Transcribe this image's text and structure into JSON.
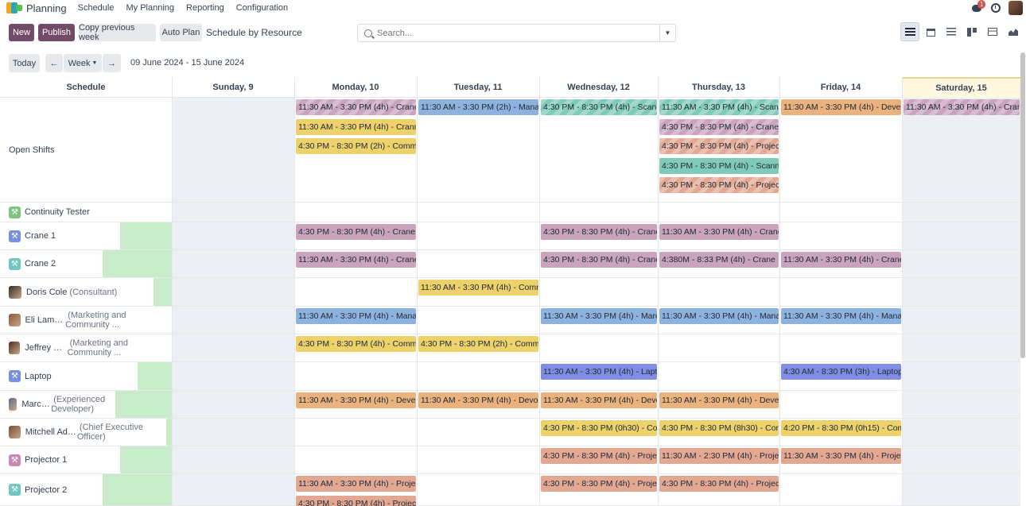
{
  "app": {
    "title": "Planning",
    "menu": [
      "Schedule",
      "My Planning",
      "Reporting",
      "Configuration"
    ],
    "notification_count": "1"
  },
  "toolbar": {
    "new_label": "New",
    "publish_label": "Publish",
    "copy_label": "Copy previous week",
    "autoplan_label": "Auto Plan",
    "view_title": "Schedule by Resource"
  },
  "search": {
    "placeholder": "Search..."
  },
  "navigation": {
    "today_label": "Today",
    "scale_label": "Week",
    "date_range": "09 June 2024 - 15 June 2024"
  },
  "grid": {
    "schedule_header": "Schedule",
    "days": [
      "Sunday, 9",
      "Monday, 10",
      "Tuesday, 11",
      "Wednesday, 12",
      "Thursday, 13",
      "Friday, 14",
      "Saturday, 15"
    ]
  },
  "rows": [
    {
      "name": "Open Shifts",
      "sub": "",
      "icon": "none"
    },
    {
      "name": "Continuity Tester",
      "sub": "",
      "icon": "wrench-icon",
      "icon_color": "#7cc47f"
    },
    {
      "name": "Crane 1",
      "sub": "",
      "icon": "wrench-icon",
      "icon_color": "#7b8fe0"
    },
    {
      "name": "Crane 2",
      "sub": "",
      "icon": "wrench-icon",
      "icon_color": "#6fc7c0"
    },
    {
      "name": "Doris Cole",
      "sub": "(Consultant)",
      "icon": "person-avatar"
    },
    {
      "name": "Eli Lambert",
      "sub": "(Marketing and Community ...",
      "icon": "person-avatar"
    },
    {
      "name": "Jeffrey Kelly",
      "sub": "(Marketing and Community ...",
      "icon": "person-avatar"
    },
    {
      "name": "Laptop",
      "sub": "",
      "icon": "wrench-icon",
      "icon_color": "#7b8fe0"
    },
    {
      "name": "Marc Demo",
      "sub": "(Experienced Developer)",
      "icon": "person-avatar"
    },
    {
      "name": "Mitchell Admin",
      "sub": "(Chief Executive Officer)",
      "icon": "person-avatar"
    },
    {
      "name": "Projector 1",
      "sub": "",
      "icon": "wrench-icon",
      "icon_color": "#c68ab5"
    },
    {
      "name": "Projector 2",
      "sub": "",
      "icon": "wrench-icon",
      "icon_color": "#6fc7c0"
    }
  ],
  "shifts": [
    {
      "row": 0,
      "day": 1,
      "slot": 0,
      "text": "11:30 AM - 3:30 PM (4h) - Crane",
      "color": "crane",
      "striped": true
    },
    {
      "row": 0,
      "day": 1,
      "slot": 1,
      "text": "11:30 AM - 3:30 PM (4h) - Cranm...",
      "color": "commu",
      "striped": false
    },
    {
      "row": 0,
      "day": 1,
      "slot": 2,
      "text": "4:30 PM - 8:30 PM (2h) - Commu...",
      "color": "commu",
      "striped": false
    },
    {
      "row": 0,
      "day": 2,
      "slot": 0,
      "text": "11:30 AM - 3:30 PM (2h) - Manag...",
      "color": "manag",
      "striped": false
    },
    {
      "row": 0,
      "day": 3,
      "slot": 0,
      "text": "4:30 PM - 8:30 PM (4h) - Scaner",
      "color": "scanner",
      "striped": true
    },
    {
      "row": 0,
      "day": 4,
      "slot": 0,
      "text": "11:30 AM - 3:30 PM (4h) - Scanner",
      "color": "scanner",
      "striped": true
    },
    {
      "row": 0,
      "day": 4,
      "slot": 1,
      "text": "4:30 PM - 8:30 PM (4h) - Crane",
      "color": "crane",
      "striped": true
    },
    {
      "row": 0,
      "day": 4,
      "slot": 2,
      "text": "4:30 PM - 8:30 PM (4h) - Projector",
      "color": "projector",
      "striped": true
    },
    {
      "row": 0,
      "day": 4,
      "slot": 3,
      "text": "4:30 PM - 8:30 PM (4h) - Scanner",
      "color": "scanner",
      "striped": false
    },
    {
      "row": 0,
      "day": 4,
      "slot": 4,
      "text": "4:30 PM - 8:30 PM (4h) - Projector",
      "color": "projector",
      "striped": true
    },
    {
      "row": 0,
      "day": 5,
      "slot": 0,
      "text": "11:30 AM - 3:30 PM (4h) - Develo...",
      "color": "develo",
      "striped": false
    },
    {
      "row": 0,
      "day": 6,
      "slot": 0,
      "text": "11:30 AM - 3:30 PM (4h) - Crane",
      "color": "crane",
      "striped": true
    },
    {
      "row": 2,
      "day": 1,
      "slot": 0,
      "text": "4:30 PM - 8:30 PM (4h) - Crane",
      "color": "crane",
      "striped": false
    },
    {
      "row": 2,
      "day": 3,
      "slot": 0,
      "text": "4:30 PM - 8:30 PM (4h) - Crane",
      "color": "crane",
      "striped": false
    },
    {
      "row": 2,
      "day": 4,
      "slot": 0,
      "text": "11:30 AM - 3:30 PM (4h) - Crane",
      "color": "crane",
      "striped": false
    },
    {
      "row": 3,
      "day": 1,
      "slot": 0,
      "text": "11:30 AM - 3:30 PM (4h) - Crane",
      "color": "crane",
      "striped": false
    },
    {
      "row": 3,
      "day": 3,
      "slot": 0,
      "text": "4:30 PM - 8:30 PM (4h) - Crane",
      "color": "crane",
      "striped": false
    },
    {
      "row": 3,
      "day": 4,
      "slot": 0,
      "text": "4:380M - 8:33 PM (4h) - Crane",
      "color": "crane",
      "striped": false
    },
    {
      "row": 3,
      "day": 5,
      "slot": 0,
      "text": "11:30 AM - 3:30 PM (4h) - Crane",
      "color": "crane",
      "striped": false
    },
    {
      "row": 4,
      "day": 2,
      "slot": 0,
      "text": "11:30 AM - 3:30 PM (4h) - Comm...",
      "color": "commu",
      "striped": false
    },
    {
      "row": 5,
      "day": 1,
      "slot": 0,
      "text": "11:30 AM - 3:30 PM (4h) - Manag...",
      "color": "manag",
      "striped": false
    },
    {
      "row": 5,
      "day": 3,
      "slot": 0,
      "text": "11:30 AM - 3:30 PM (4h) - Maro...",
      "color": "manag",
      "striped": false
    },
    {
      "row": 5,
      "day": 4,
      "slot": 0,
      "text": "11:30 AM - 3:30 PM (4h) - Manag...",
      "color": "manag",
      "striped": false
    },
    {
      "row": 5,
      "day": 5,
      "slot": 0,
      "text": "11:30 AM - 3:30 PM (4h) - Manag...",
      "color": "manag",
      "striped": false
    },
    {
      "row": 6,
      "day": 1,
      "slot": 0,
      "text": "4:30 PM - 8:30 PM (4h) - Commu...",
      "color": "commu",
      "striped": false
    },
    {
      "row": 6,
      "day": 2,
      "slot": 0,
      "text": "4:30 PM - 8:30 PM (2h) - Commu...",
      "color": "commu",
      "striped": false
    },
    {
      "row": 7,
      "day": 3,
      "slot": 0,
      "text": "11:30 AM - 3:30 PM (4h) - Laptop",
      "color": "laptop",
      "striped": false
    },
    {
      "row": 7,
      "day": 5,
      "slot": 0,
      "text": "4:30 AM - 8:30 PM (3h) - Laptop",
      "color": "laptop",
      "striped": false
    },
    {
      "row": 8,
      "day": 1,
      "slot": 0,
      "text": "11:30 AM - 3:30 PM (4h) - Develo...",
      "color": "develo",
      "striped": false
    },
    {
      "row": 8,
      "day": 2,
      "slot": 0,
      "text": "11:30 AM - 3:30 PM (4h) - Devo...",
      "color": "develo",
      "striped": false
    },
    {
      "row": 8,
      "day": 3,
      "slot": 0,
      "text": "11:30 AM - 3:30 PM (4h) - Develo...",
      "color": "develo",
      "striped": false
    },
    {
      "row": 8,
      "day": 4,
      "slot": 0,
      "text": "11:30 AM - 3:30 PM (4h) - Develo...",
      "color": "develo",
      "striped": false
    },
    {
      "row": 9,
      "day": 3,
      "slot": 0,
      "text": "4:30 PM - 8:30 PM (0h30) - Com...",
      "color": "commu",
      "striped": false
    },
    {
      "row": 9,
      "day": 4,
      "slot": 0,
      "text": "4:30 PM - 8:30 PM (8h30) - Com...",
      "color": "commu",
      "striped": false
    },
    {
      "row": 9,
      "day": 5,
      "slot": 0,
      "text": "4:20 PM - 8:30 PM (0h15) - Com...",
      "color": "commu",
      "striped": false
    },
    {
      "row": 10,
      "day": 3,
      "slot": 0,
      "text": "4:30 PM - 8:30 PM (4h) - Projector",
      "color": "projector",
      "striped": false
    },
    {
      "row": 10,
      "day": 4,
      "slot": 0,
      "text": "11:30 AM - 2:30 PM (4h) - Projec...",
      "color": "projector",
      "striped": false
    },
    {
      "row": 10,
      "day": 5,
      "slot": 0,
      "text": "11:30 AM - 3:30 PM (4h) - Projec...",
      "color": "projector",
      "striped": false
    },
    {
      "row": 11,
      "day": 1,
      "slot": 0,
      "text": "11:30 AM - 3:30 PM (4h) - Projec...",
      "color": "projector",
      "striped": false
    },
    {
      "row": 11,
      "day": 1,
      "slot": 1,
      "text": "4:30 PM - 8:30 PM (4h) - Projector",
      "color": "projector",
      "striped": false
    },
    {
      "row": 11,
      "day": 3,
      "slot": 0,
      "text": "4:30 PM - 8:30 PM (4h) - Projector",
      "color": "projector",
      "striped": false
    },
    {
      "row": 11,
      "day": 4,
      "slot": 0,
      "text": "4:30 PM - 8:30 PM (4h) - Projector",
      "color": "projector",
      "striped": false
    }
  ],
  "colors": {
    "brand": "#714b67",
    "crane": "#c9a4bc",
    "manag": "#8eb2de",
    "scanner": "#80cbb8",
    "develo": "#eab27c",
    "commu": "#edd16b",
    "projector": "#e3a892",
    "laptop": "#7f8ee3",
    "today_header": "#fff8e1"
  }
}
